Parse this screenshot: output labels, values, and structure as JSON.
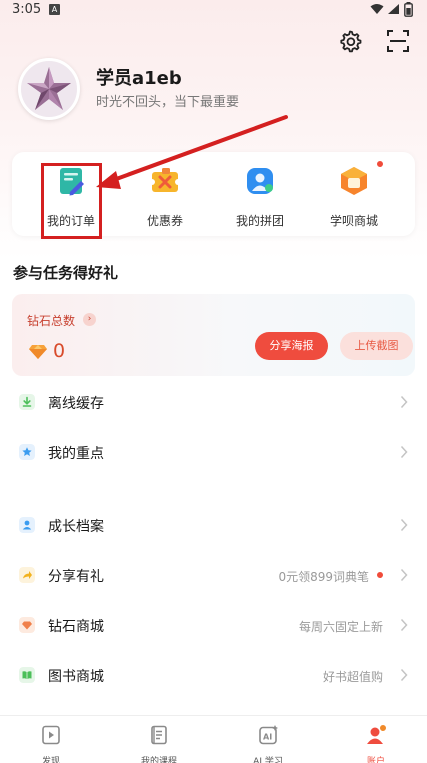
{
  "status_bar": {
    "time": "3:05",
    "notification_letter": "A"
  },
  "profile": {
    "name": "学员a1eb",
    "motto": "时光不回头，当下最重要"
  },
  "quick_actions": [
    {
      "label": "我的订单",
      "icon": "order-icon"
    },
    {
      "label": "优惠券",
      "icon": "coupon-icon"
    },
    {
      "label": "我的拼团",
      "icon": "group-buy-icon"
    },
    {
      "label": "学呗商城",
      "icon": "store-icon",
      "badge_dot": true
    }
  ],
  "tasks": {
    "title": "参与任务得好礼",
    "diamond_label": "钻石总数",
    "diamond_value": "0",
    "share_button": "分享海报",
    "upload_button": "上传截图"
  },
  "menu": [
    {
      "label": "离线缓存",
      "right_text": "",
      "icon": "download-icon",
      "color": "#4cbf5a"
    },
    {
      "label": "我的重点",
      "right_text": "",
      "icon": "star-icon",
      "color": "#3a9cf0"
    },
    {
      "label": "成长档案",
      "right_text": "",
      "icon": "profile-icon",
      "color": "#3a9cf0"
    },
    {
      "label": "分享有礼",
      "right_text": "0元领899词典笔",
      "icon": "share-icon",
      "color": "#f2b21e",
      "badge_dot": true
    },
    {
      "label": "钻石商城",
      "right_text": "每周六固定上新",
      "icon": "diamond-icon",
      "color": "#f0804a"
    },
    {
      "label": "图书商城",
      "right_text": "好书超值购",
      "icon": "book-icon",
      "color": "#4cbf5a"
    }
  ],
  "bottom_nav": [
    {
      "label": "发现",
      "icon": "discover-icon",
      "active": false
    },
    {
      "label": "我的课程",
      "icon": "courses-icon",
      "active": false
    },
    {
      "label": "AI 学习",
      "icon": "ai-learning-icon",
      "active": false
    },
    {
      "label": "账户",
      "icon": "account-icon",
      "active": true
    }
  ],
  "colors": {
    "accent": "#ef4c3e",
    "highlight": "#d42020"
  }
}
